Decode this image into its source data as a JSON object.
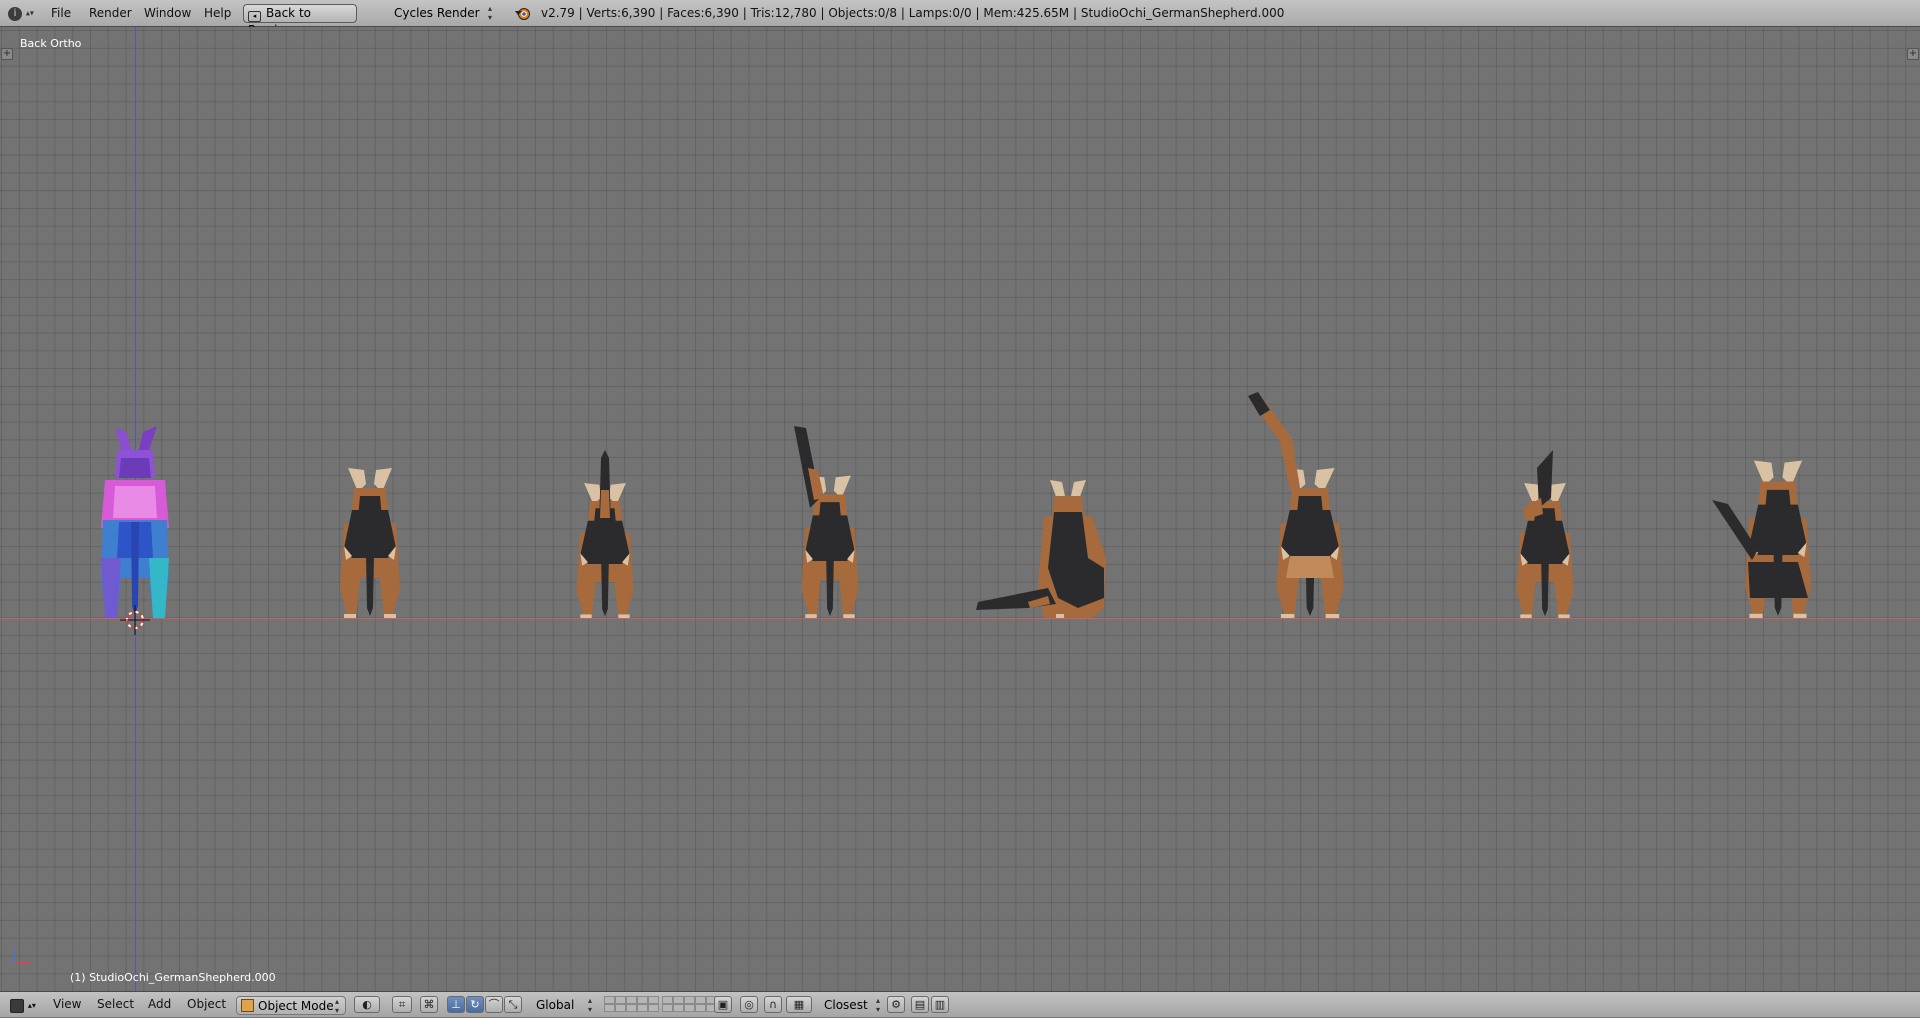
{
  "top_header": {
    "editor_icon": "info-icon",
    "menus": [
      "File",
      "Render",
      "Window",
      "Help"
    ],
    "back_button": "Back to Previous",
    "render_engine": "Cycles Render",
    "blender_icon": "blender-logo-icon",
    "stats": "v2.79 | Verts:6,390 | Faces:6,390 | Tris:12,780 | Objects:0/8 | Lamps:0/0 | Mem:425.65M | StudioOchi_GermanShepherd.000"
  },
  "viewport": {
    "view_name": "Back Ortho",
    "active_object": "(1) StudioOchi_GermanShepherd.000",
    "colors": {
      "background": "#737373",
      "x_axis": "#c66262",
      "z_axis": "#5656b8",
      "dog_tan": "#a66a3c",
      "dog_black": "#2b2b2d",
      "dog_light": "#d9c2a4"
    },
    "objects": [
      "dog-model-selected",
      "dog-model-2",
      "dog-model-3",
      "dog-model-4",
      "dog-model-5",
      "dog-model-6",
      "dog-model-7",
      "dog-model-8"
    ]
  },
  "bottom_header": {
    "editor_icon": "cube-icon",
    "menus": [
      "View",
      "Select",
      "Add",
      "Object"
    ],
    "mode": "Object Mode",
    "orientation": "Global",
    "snap_target": "Closest"
  }
}
